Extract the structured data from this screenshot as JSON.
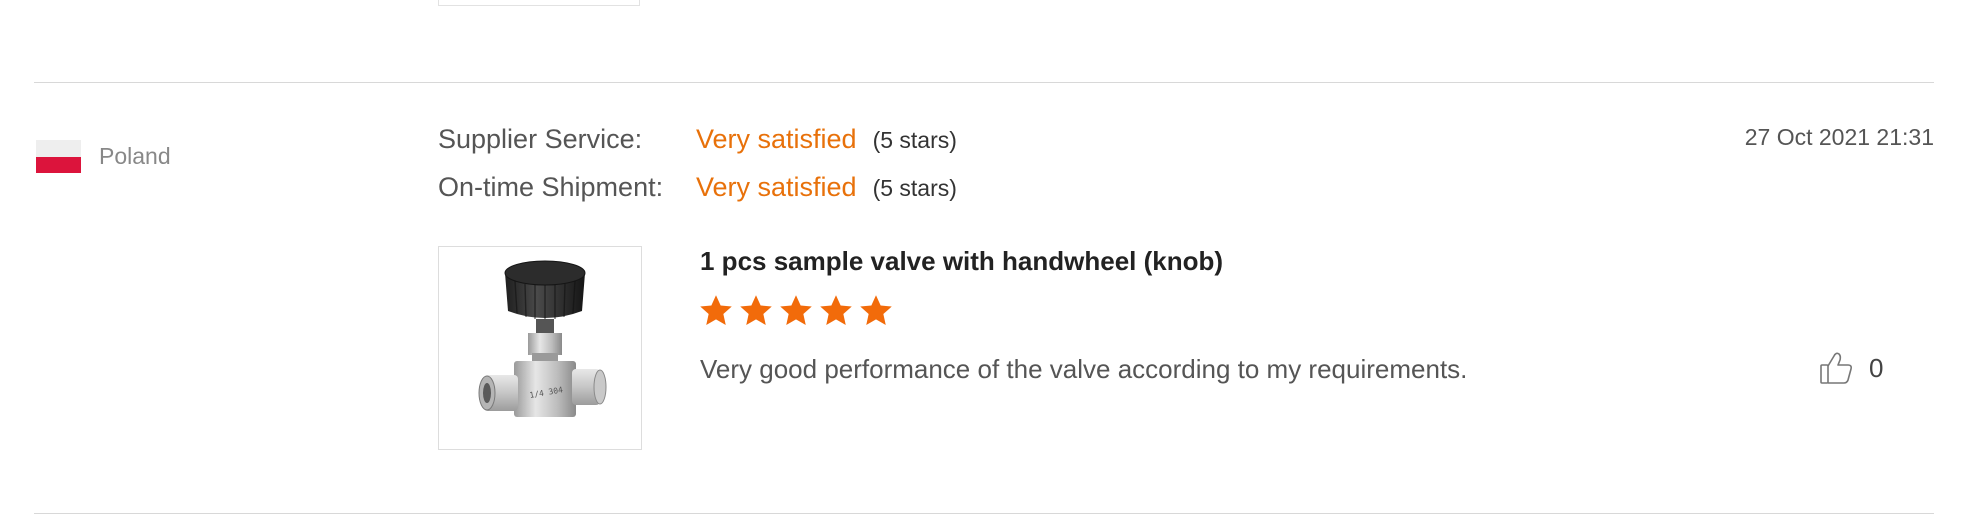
{
  "review": {
    "country": "Poland",
    "flag_colors": {
      "top": "#eeeeee",
      "bottom": "#dc143c"
    },
    "ratings": [
      {
        "label": "Supplier Service:",
        "value": "Very satisfied",
        "stars_note": "(5 stars)"
      },
      {
        "label": "On-time Shipment:",
        "value": "Very satisfied",
        "stars_note": "(5 stars)"
      }
    ],
    "date": "27 Oct 2021 21:31",
    "product_title": "1 pcs sample valve with handwheel (knob)",
    "product_image_icon": "needle-valve-image",
    "star_rating": 5,
    "star_color": "#f26b0a",
    "text": "Very good performance of the valve according to my requirements.",
    "like_icon": "thumbs-up-icon",
    "like_count": "0"
  },
  "colors": {
    "accent": "#e8710a",
    "divider": "#d8d8d8"
  }
}
